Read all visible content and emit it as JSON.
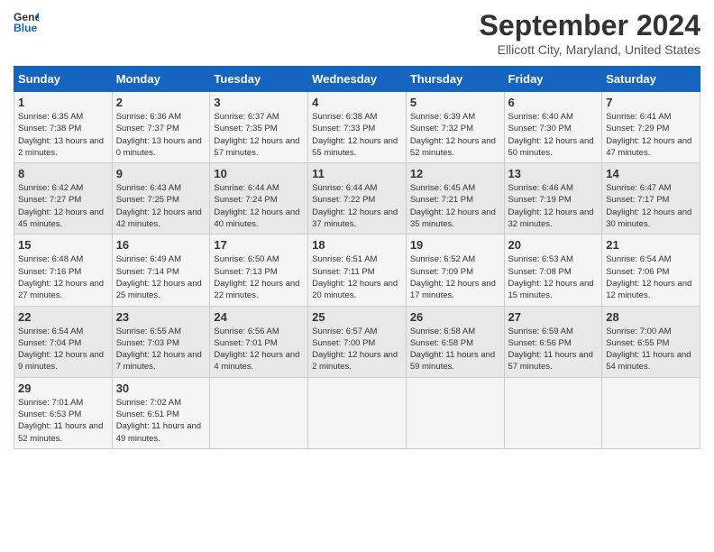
{
  "logo": {
    "line1": "General",
    "line2": "Blue"
  },
  "title": "September 2024",
  "location": "Ellicott City, Maryland, United States",
  "days_of_week": [
    "Sunday",
    "Monday",
    "Tuesday",
    "Wednesday",
    "Thursday",
    "Friday",
    "Saturday"
  ],
  "weeks": [
    [
      {
        "num": "1",
        "sunrise": "6:35 AM",
        "sunset": "7:38 PM",
        "daylight": "13 hours and 2 minutes."
      },
      {
        "num": "2",
        "sunrise": "6:36 AM",
        "sunset": "7:37 PM",
        "daylight": "13 hours and 0 minutes."
      },
      {
        "num": "3",
        "sunrise": "6:37 AM",
        "sunset": "7:35 PM",
        "daylight": "12 hours and 57 minutes."
      },
      {
        "num": "4",
        "sunrise": "6:38 AM",
        "sunset": "7:33 PM",
        "daylight": "12 hours and 55 minutes."
      },
      {
        "num": "5",
        "sunrise": "6:39 AM",
        "sunset": "7:32 PM",
        "daylight": "12 hours and 52 minutes."
      },
      {
        "num": "6",
        "sunrise": "6:40 AM",
        "sunset": "7:30 PM",
        "daylight": "12 hours and 50 minutes."
      },
      {
        "num": "7",
        "sunrise": "6:41 AM",
        "sunset": "7:29 PM",
        "daylight": "12 hours and 47 minutes."
      }
    ],
    [
      {
        "num": "8",
        "sunrise": "6:42 AM",
        "sunset": "7:27 PM",
        "daylight": "12 hours and 45 minutes."
      },
      {
        "num": "9",
        "sunrise": "6:43 AM",
        "sunset": "7:25 PM",
        "daylight": "12 hours and 42 minutes."
      },
      {
        "num": "10",
        "sunrise": "6:44 AM",
        "sunset": "7:24 PM",
        "daylight": "12 hours and 40 minutes."
      },
      {
        "num": "11",
        "sunrise": "6:44 AM",
        "sunset": "7:22 PM",
        "daylight": "12 hours and 37 minutes."
      },
      {
        "num": "12",
        "sunrise": "6:45 AM",
        "sunset": "7:21 PM",
        "daylight": "12 hours and 35 minutes."
      },
      {
        "num": "13",
        "sunrise": "6:46 AM",
        "sunset": "7:19 PM",
        "daylight": "12 hours and 32 minutes."
      },
      {
        "num": "14",
        "sunrise": "6:47 AM",
        "sunset": "7:17 PM",
        "daylight": "12 hours and 30 minutes."
      }
    ],
    [
      {
        "num": "15",
        "sunrise": "6:48 AM",
        "sunset": "7:16 PM",
        "daylight": "12 hours and 27 minutes."
      },
      {
        "num": "16",
        "sunrise": "6:49 AM",
        "sunset": "7:14 PM",
        "daylight": "12 hours and 25 minutes."
      },
      {
        "num": "17",
        "sunrise": "6:50 AM",
        "sunset": "7:13 PM",
        "daylight": "12 hours and 22 minutes."
      },
      {
        "num": "18",
        "sunrise": "6:51 AM",
        "sunset": "7:11 PM",
        "daylight": "12 hours and 20 minutes."
      },
      {
        "num": "19",
        "sunrise": "6:52 AM",
        "sunset": "7:09 PM",
        "daylight": "12 hours and 17 minutes."
      },
      {
        "num": "20",
        "sunrise": "6:53 AM",
        "sunset": "7:08 PM",
        "daylight": "12 hours and 15 minutes."
      },
      {
        "num": "21",
        "sunrise": "6:54 AM",
        "sunset": "7:06 PM",
        "daylight": "12 hours and 12 minutes."
      }
    ],
    [
      {
        "num": "22",
        "sunrise": "6:54 AM",
        "sunset": "7:04 PM",
        "daylight": "12 hours and 9 minutes."
      },
      {
        "num": "23",
        "sunrise": "6:55 AM",
        "sunset": "7:03 PM",
        "daylight": "12 hours and 7 minutes."
      },
      {
        "num": "24",
        "sunrise": "6:56 AM",
        "sunset": "7:01 PM",
        "daylight": "12 hours and 4 minutes."
      },
      {
        "num": "25",
        "sunrise": "6:57 AM",
        "sunset": "7:00 PM",
        "daylight": "12 hours and 2 minutes."
      },
      {
        "num": "26",
        "sunrise": "6:58 AM",
        "sunset": "6:58 PM",
        "daylight": "11 hours and 59 minutes."
      },
      {
        "num": "27",
        "sunrise": "6:59 AM",
        "sunset": "6:56 PM",
        "daylight": "11 hours and 57 minutes."
      },
      {
        "num": "28",
        "sunrise": "7:00 AM",
        "sunset": "6:55 PM",
        "daylight": "11 hours and 54 minutes."
      }
    ],
    [
      {
        "num": "29",
        "sunrise": "7:01 AM",
        "sunset": "6:53 PM",
        "daylight": "11 hours and 52 minutes."
      },
      {
        "num": "30",
        "sunrise": "7:02 AM",
        "sunset": "6:51 PM",
        "daylight": "11 hours and 49 minutes."
      },
      null,
      null,
      null,
      null,
      null
    ]
  ]
}
